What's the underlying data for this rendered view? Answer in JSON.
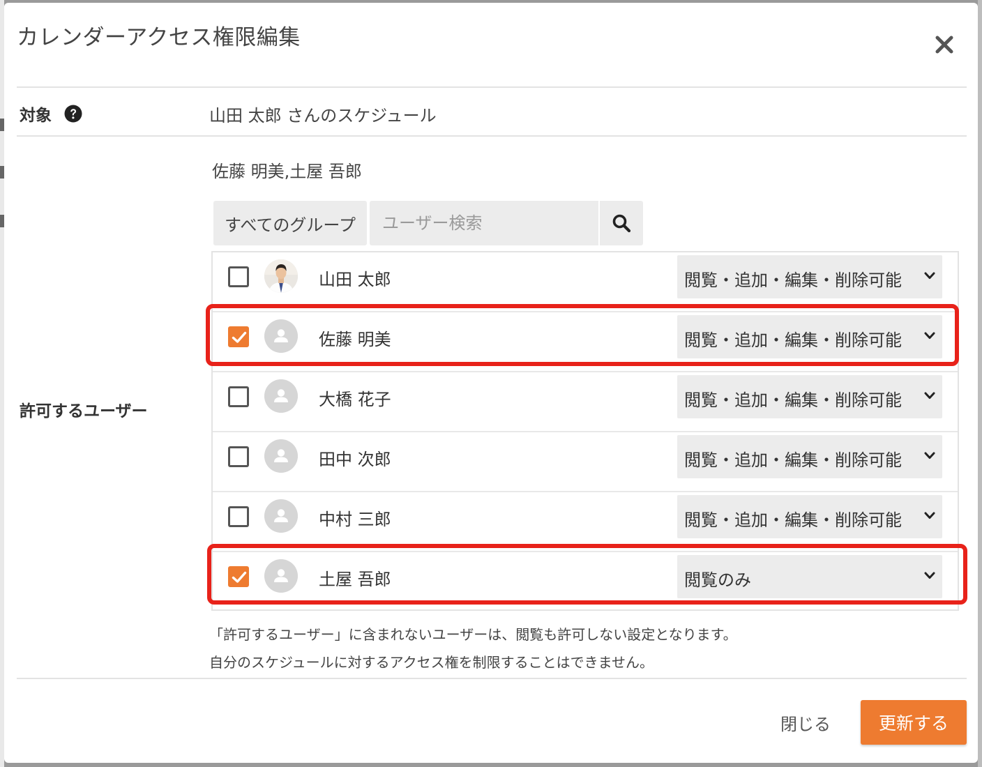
{
  "dialog": {
    "title": "カレンダーアクセス権限編集"
  },
  "target": {
    "label": "対象",
    "value": "山田 太郎 さんのスケジュール"
  },
  "allowed_users": {
    "label": "許可するユーザー",
    "selected_summary": "佐藤 明美,土屋 吾郎",
    "group_select": "すべてのグループ",
    "search_placeholder": "ユーザー検索",
    "users": [
      {
        "name": "山田 太郎",
        "checked": false,
        "permission": "閲覧・追加・編集・削除可能",
        "avatar": "photo"
      },
      {
        "name": "佐藤 明美",
        "checked": true,
        "permission": "閲覧・追加・編集・削除可能",
        "avatar": "default"
      },
      {
        "name": "大橋 花子",
        "checked": false,
        "permission": "閲覧・追加・編集・削除可能",
        "avatar": "default"
      },
      {
        "name": "田中 次郎",
        "checked": false,
        "permission": "閲覧・追加・編集・削除可能",
        "avatar": "default"
      },
      {
        "name": "中村 三郎",
        "checked": false,
        "permission": "閲覧・追加・編集・削除可能",
        "avatar": "default"
      },
      {
        "name": "土屋 吾郎",
        "checked": true,
        "permission": "閲覧のみ",
        "avatar": "default"
      }
    ]
  },
  "notes": [
    "「許可するユーザー」に含まれないユーザーは、閲覧も許可しない設定となります。",
    "自分のスケジュールに対するアクセス権を制限することはできません。"
  ],
  "footer": {
    "close_label": "閉じる",
    "update_label": "更新する"
  },
  "colors": {
    "accent": "#ee7b30",
    "highlight": "#e8221a"
  }
}
